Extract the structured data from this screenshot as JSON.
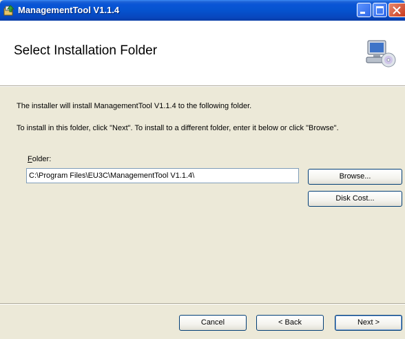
{
  "window": {
    "title": "ManagementTool V1.1.4",
    "icon": "installer-icon",
    "controls": [
      "minimize-icon",
      "maximize-icon",
      "close-icon"
    ]
  },
  "header": {
    "title": "Select Installation Folder",
    "icon": "computer-cd-icon"
  },
  "body": {
    "line1": "The installer will install ManagementTool V1.1.4 to the following folder.",
    "line2": "To install in this folder, click \"Next\". To install to a different folder, enter it below or click \"Browse\".",
    "folder_label_mnemonic": "F",
    "folder_label_rest": "older:",
    "folder_value": "C:\\Program Files\\EU3C\\ManagementTool V1.1.4\\"
  },
  "buttons": {
    "browse": "Browse...",
    "disk_cost": "Disk Cost...",
    "cancel": "Cancel",
    "back": "< Back",
    "next": "Next >"
  },
  "colors": {
    "titlebar": "#0553cf",
    "dialog_bg": "#ece9d8",
    "header_bg": "#ffffff"
  }
}
